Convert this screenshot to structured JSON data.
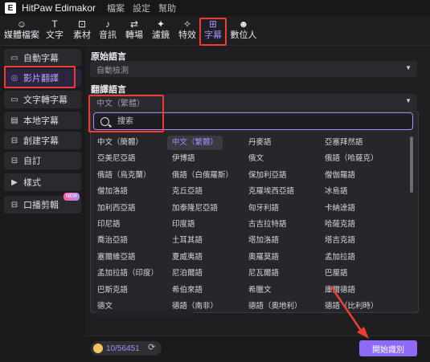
{
  "app": {
    "name": "HitPaw Edimakor",
    "logo_letter": "E"
  },
  "menu": [
    "檔案",
    "設定",
    "幫助"
  ],
  "toolbar": [
    {
      "label": "媒體檔案",
      "icon": "media-icon",
      "glyph": "☺"
    },
    {
      "label": "文字",
      "icon": "text-icon",
      "glyph": "T"
    },
    {
      "label": "素材",
      "icon": "material-icon",
      "glyph": "⊡"
    },
    {
      "label": "音訊",
      "icon": "audio-icon",
      "glyph": "♪"
    },
    {
      "label": "轉場",
      "icon": "transition-icon",
      "glyph": "⇄"
    },
    {
      "label": "濾鏡",
      "icon": "filter-icon",
      "glyph": "✦"
    },
    {
      "label": "特效",
      "icon": "effects-icon",
      "glyph": "✧"
    },
    {
      "label": "字幕",
      "icon": "subtitle-icon",
      "glyph": "⊞",
      "active": true
    },
    {
      "label": "數位人",
      "icon": "avatar-icon",
      "glyph": "☻"
    }
  ],
  "sidebar": [
    {
      "label": "自動字幕",
      "icon": "auto-subtitle-icon",
      "glyph": "▭"
    },
    {
      "label": "影片翻譯",
      "icon": "video-translate-icon",
      "glyph": "◎",
      "active": true
    },
    {
      "label": "文字轉字幕",
      "icon": "text-to-subtitle-icon",
      "glyph": "▭"
    },
    {
      "label": "本地字幕",
      "icon": "local-subtitle-icon",
      "glyph": "▤"
    },
    {
      "label": "創建字幕",
      "icon": "create-subtitle-icon",
      "glyph": "⊟"
    },
    {
      "label": "自訂",
      "icon": "custom-icon",
      "glyph": "⊟"
    },
    {
      "label": "樣式",
      "icon": "caret-right-icon",
      "glyph": "▶"
    },
    {
      "label": "口播剪輯",
      "icon": "speech-edit-icon",
      "glyph": "⊟",
      "badge": "NEW"
    }
  ],
  "source_language": {
    "label": "原始語言",
    "value": "自動檢測"
  },
  "target_language": {
    "label": "翻譯語言",
    "value": "中文（繁體）"
  },
  "search": {
    "placeholder": "搜索"
  },
  "languages": [
    "中文（簡體）",
    "中文（繁體）",
    "丹麥語",
    "亞塞拜然語",
    "亞美尼亞語",
    "伊博語",
    "俄文",
    "俄語（哈薩克）",
    "俄語（烏克蘭）",
    "俄語（白俄羅斯）",
    "保加利亞語",
    "僧伽羅語",
    "僧加洛語",
    "克丘亞語",
    "克羅埃西亞語",
    "冰島語",
    "加利西亞語",
    "加泰隆尼亞語",
    "匈牙利語",
    "卡納達語",
    "印尼語",
    "印度語",
    "古吉拉特語",
    "哈薩克語",
    "喬治亞語",
    "土耳其語",
    "塔加洛語",
    "塔吉克語",
    "塞爾維亞語",
    "夏威夷語",
    "奧羅莫語",
    "孟加拉語",
    "孟加拉語（印度）",
    "尼泊爾語",
    "尼瓦爾語",
    "巴厘語",
    "巴斯克語",
    "希伯來語",
    "希臘文",
    "庫爾德語",
    "德文",
    "德語（南非）",
    "德語（奧地利）",
    "德語（比利時）"
  ],
  "selected_language_index": 1,
  "credits": {
    "value": "10/56451"
  },
  "start_button": {
    "label": "開始識別"
  },
  "colors": {
    "accent": "#a78bfa",
    "highlight": "#ef3b35",
    "button": "#8f6bf5"
  }
}
